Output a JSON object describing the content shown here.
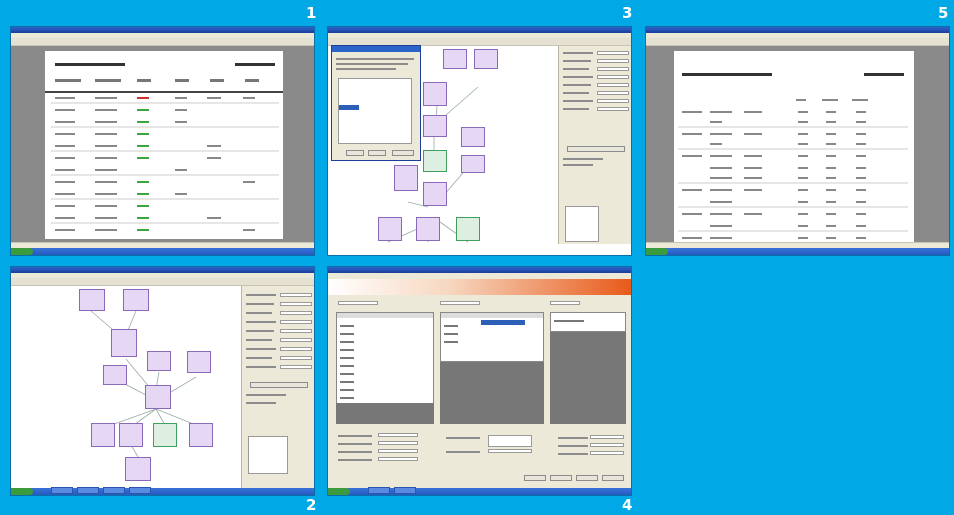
{
  "numbers": {
    "n1": "1",
    "n2": "2",
    "n3": "3",
    "n4": "4",
    "n5": "5"
  },
  "colors": {
    "background": "#00a9e6",
    "node_border": "#8a6ab8",
    "node_fill": "#e6d8f4",
    "node_green": "#3f9f5f"
  },
  "icons": [
    "start-button-icon",
    "taskbar-item-icon"
  ]
}
